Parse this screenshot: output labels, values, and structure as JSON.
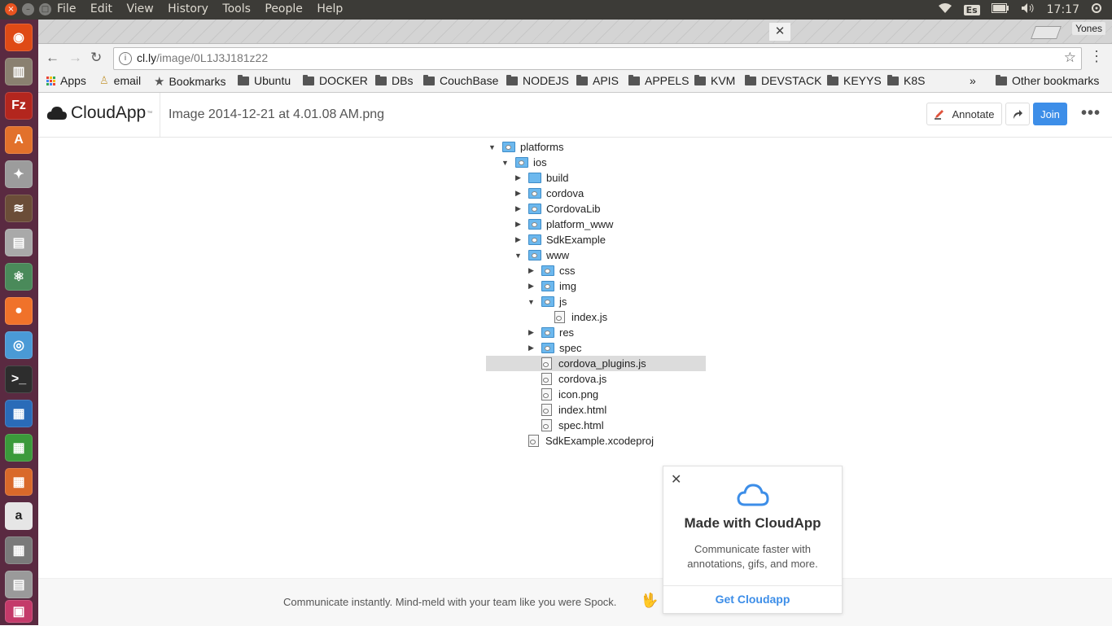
{
  "system": {
    "menu": [
      "File",
      "Edit",
      "View",
      "History",
      "Tools",
      "People",
      "Help"
    ],
    "keyboard": "Es",
    "clock": "17:17"
  },
  "browser": {
    "profile": "Yones",
    "url_host": "cl.ly",
    "url_path": "/image/0L1J3J181z22",
    "bookmarks": [
      "Apps",
      "email",
      "Bookmarks",
      "Ubuntu",
      "DOCKER",
      "DBs",
      "CouchBase",
      "NODEJS",
      "APIS",
      "APPELS",
      "KVM",
      "DEVSTACK",
      "KEYYS",
      "K8S"
    ],
    "bookmarks_overflow": "»",
    "other_bookmarks": "Other bookmarks"
  },
  "cloudapp": {
    "logo": "CloudApp",
    "filename": "Image 2014-12-21 at 4.01.08 AM.png",
    "annotate": "Annotate",
    "join": "Join",
    "accent": "#3d8ee8"
  },
  "tree": [
    {
      "name": "platforms",
      "depth": 0,
      "kind": "folder",
      "state": "open"
    },
    {
      "name": "ios",
      "depth": 1,
      "kind": "folder",
      "state": "open"
    },
    {
      "name": "build",
      "depth": 2,
      "kind": "folder-plain",
      "state": "closed"
    },
    {
      "name": "cordova",
      "depth": 2,
      "kind": "folder",
      "state": "closed"
    },
    {
      "name": "CordovaLib",
      "depth": 2,
      "kind": "folder",
      "state": "closed"
    },
    {
      "name": "platform_www",
      "depth": 2,
      "kind": "folder",
      "state": "closed"
    },
    {
      "name": "SdkExample",
      "depth": 2,
      "kind": "folder",
      "state": "closed"
    },
    {
      "name": "www",
      "depth": 2,
      "kind": "folder",
      "state": "open"
    },
    {
      "name": "css",
      "depth": 3,
      "kind": "folder",
      "state": "closed"
    },
    {
      "name": "img",
      "depth": 3,
      "kind": "folder",
      "state": "closed"
    },
    {
      "name": "js",
      "depth": 3,
      "kind": "folder",
      "state": "open"
    },
    {
      "name": "index.js",
      "depth": 4,
      "kind": "file"
    },
    {
      "name": "res",
      "depth": 3,
      "kind": "folder",
      "state": "closed"
    },
    {
      "name": "spec",
      "depth": 3,
      "kind": "folder",
      "state": "closed"
    },
    {
      "name": "cordova_plugins.js",
      "depth": 3,
      "kind": "file",
      "selected": true
    },
    {
      "name": "cordova.js",
      "depth": 3,
      "kind": "file"
    },
    {
      "name": "icon.png",
      "depth": 3,
      "kind": "file"
    },
    {
      "name": "index.html",
      "depth": 3,
      "kind": "file"
    },
    {
      "name": "spec.html",
      "depth": 3,
      "kind": "file"
    },
    {
      "name": "SdkExample.xcodeproj",
      "depth": 2,
      "kind": "file"
    }
  ],
  "promo": {
    "close": "✕",
    "title": "Made with CloudApp",
    "description": "Communicate faster with annotations, gifs, and more.",
    "link": "Get Cloudapp"
  },
  "footer": {
    "text": "Communicate instantly. Mind-meld with your team like you were Spock.",
    "emoji": "🖖"
  }
}
